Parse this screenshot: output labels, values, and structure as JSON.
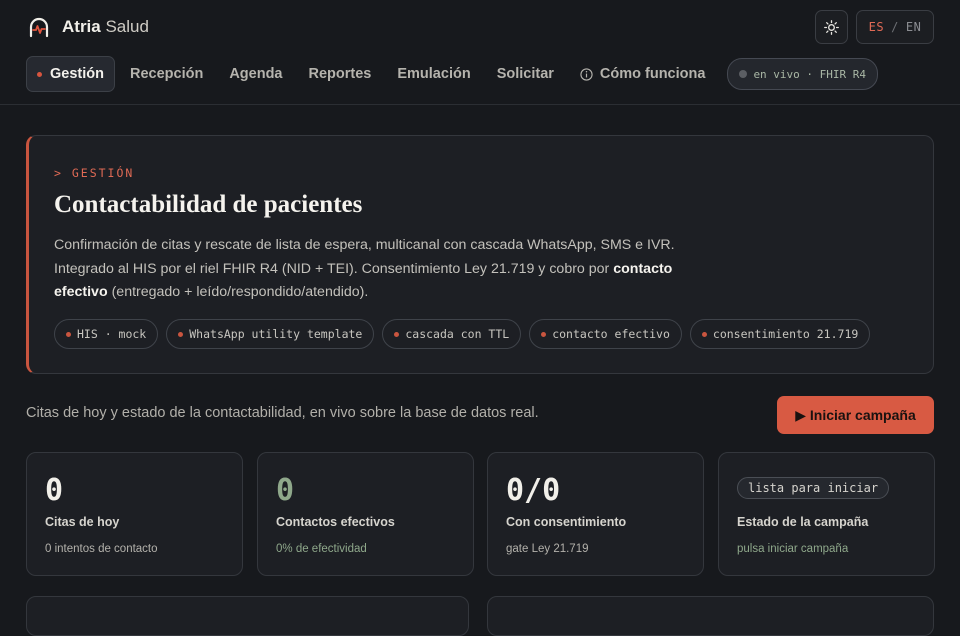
{
  "brand": {
    "name_bold": "Atria",
    "name_light": "Salud"
  },
  "header": {
    "theme_icon": "sun-icon",
    "lang": {
      "es": "ES",
      "sep": "/",
      "en": "EN"
    }
  },
  "nav": {
    "items": [
      {
        "label": "Gestión",
        "active": true
      },
      {
        "label": "Recepción"
      },
      {
        "label": "Agenda"
      },
      {
        "label": "Reportes"
      },
      {
        "label": "Emulación"
      },
      {
        "label": "Solicitar"
      },
      {
        "label": "Cómo funciona",
        "icon": "info-icon"
      }
    ],
    "live_status": "en vivo · FHIR R4"
  },
  "hero": {
    "eyebrow": "> GESTIÓN",
    "title": "Contactabilidad de pacientes",
    "desc_line1": "Confirmación de citas y rescate de lista de espera, multicanal con cascada WhatsApp, SMS e IVR.",
    "desc_line2a": "Integrado al HIS por el riel FHIR R4 (NID + TEI). Consentimiento Ley 21.719 y cobro por",
    "desc_bold": "contacto efectivo",
    "desc_line3": "(entregado + leído/respondido/atendido).",
    "tags": [
      "HIS · mock",
      "WhatsApp utility template",
      "cascada con TTL",
      "contacto efectivo",
      "consentimiento 21.719"
    ]
  },
  "summary": {
    "text": "Citas de hoy y estado de la contactabilidad, en vivo sobre la base de datos real.",
    "cta": "▶ Iniciar campaña"
  },
  "stats": [
    {
      "value": "0",
      "label": "Citas de hoy",
      "sub": "0 intentos de contacto"
    },
    {
      "value": "0",
      "label": "Contactos efectivos",
      "sub": "0% de efectividad"
    },
    {
      "value": "0/0",
      "label": "Con consentimiento",
      "sub": "gate Ley 21.719"
    },
    {
      "badge": "lista para iniciar",
      "label": "Estado de la campaña",
      "sub": "pulsa iniciar campaña"
    }
  ],
  "colors": {
    "background": "#17191d",
    "accent": "#d85a43",
    "positive": "#8fa88b",
    "card": "#1d1f24"
  }
}
